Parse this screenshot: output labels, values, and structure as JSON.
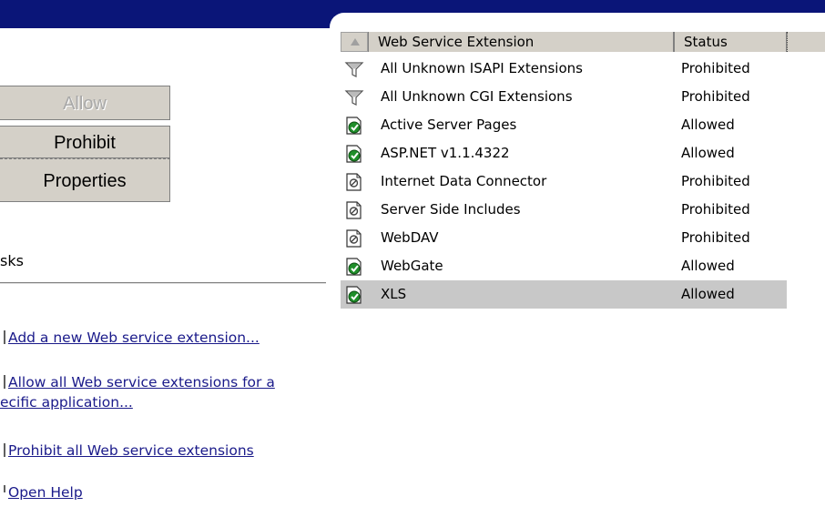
{
  "buttons": {
    "allow": "Allow",
    "prohibit": "Prohibit",
    "properties": "Properties"
  },
  "tasks": {
    "header": "sks",
    "items": [
      {
        "text": "Add a new Web service extension..."
      },
      {
        "text": "Allow all Web service extensions for a",
        "text2": "ecific application..."
      },
      {
        "text": "Prohibit all Web service extensions"
      },
      {
        "text": "Open Help"
      }
    ]
  },
  "list": {
    "columns": {
      "name": "Web Service Extension",
      "status": "Status"
    },
    "rows": [
      {
        "name": "All Unknown ISAPI Extensions",
        "status": "Prohibited",
        "icon": "filter-icon"
      },
      {
        "name": "All Unknown CGI Extensions",
        "status": "Prohibited",
        "icon": "filter-icon"
      },
      {
        "name": "Active Server Pages",
        "status": "Allowed",
        "icon": "allowed-extension-icon"
      },
      {
        "name": "ASP.NET v1.1.4322",
        "status": "Allowed",
        "icon": "allowed-extension-icon"
      },
      {
        "name": "Internet Data Connector",
        "status": "Prohibited",
        "icon": "prohibited-extension-icon"
      },
      {
        "name": "Server Side Includes",
        "status": "Prohibited",
        "icon": "prohibited-extension-icon"
      },
      {
        "name": "WebDAV",
        "status": "Prohibited",
        "icon": "prohibited-extension-icon"
      },
      {
        "name": "WebGate",
        "status": "Allowed",
        "icon": "allowed-extension-icon"
      },
      {
        "name": "XLS",
        "status": "Allowed",
        "icon": "allowed-extension-icon",
        "selected": true
      }
    ]
  },
  "colors": {
    "top_band": "#0a1578",
    "button_face": "#d4d0c8",
    "selection": "#c8c8c8",
    "link": "#1a1a8a"
  }
}
